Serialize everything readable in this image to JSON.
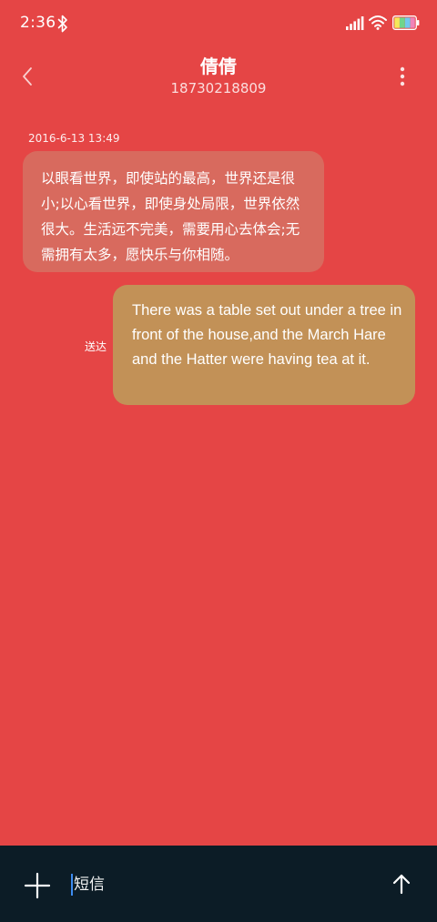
{
  "status_bar": {
    "time": "2:36",
    "icons": [
      "bluetooth-icon",
      "signal-icon",
      "wifi-icon",
      "battery-icon"
    ]
  },
  "header": {
    "contact_name": "倩倩",
    "contact_number": "18730218809",
    "icons": [
      "back-icon",
      "more-icon"
    ]
  },
  "conversation": {
    "timestamp": "2016-6-13 13:49",
    "messages": [
      {
        "direction": "incoming",
        "text": "以眼看世界，即使站的最高，世界还是很小;以心看世界，即使身处局限，世界依然很大。生活远不完美，需要用心去体会;无需拥有太多，愿快乐与你相随。"
      },
      {
        "direction": "outgoing",
        "text": "There was a table set out under a tree in front of the house,and the March Hare and the Hatter were having tea at it.",
        "status": "送达"
      }
    ]
  },
  "composer": {
    "placeholder": "短信",
    "icons": [
      "add-icon",
      "send-arrow-icon"
    ]
  },
  "colors": {
    "background": "#e54545",
    "incoming_bubble": "#d86a5e",
    "outgoing_bubble": "#c29157",
    "bottom_bar": "#0c1c26",
    "caret": "#3d8cf0"
  }
}
